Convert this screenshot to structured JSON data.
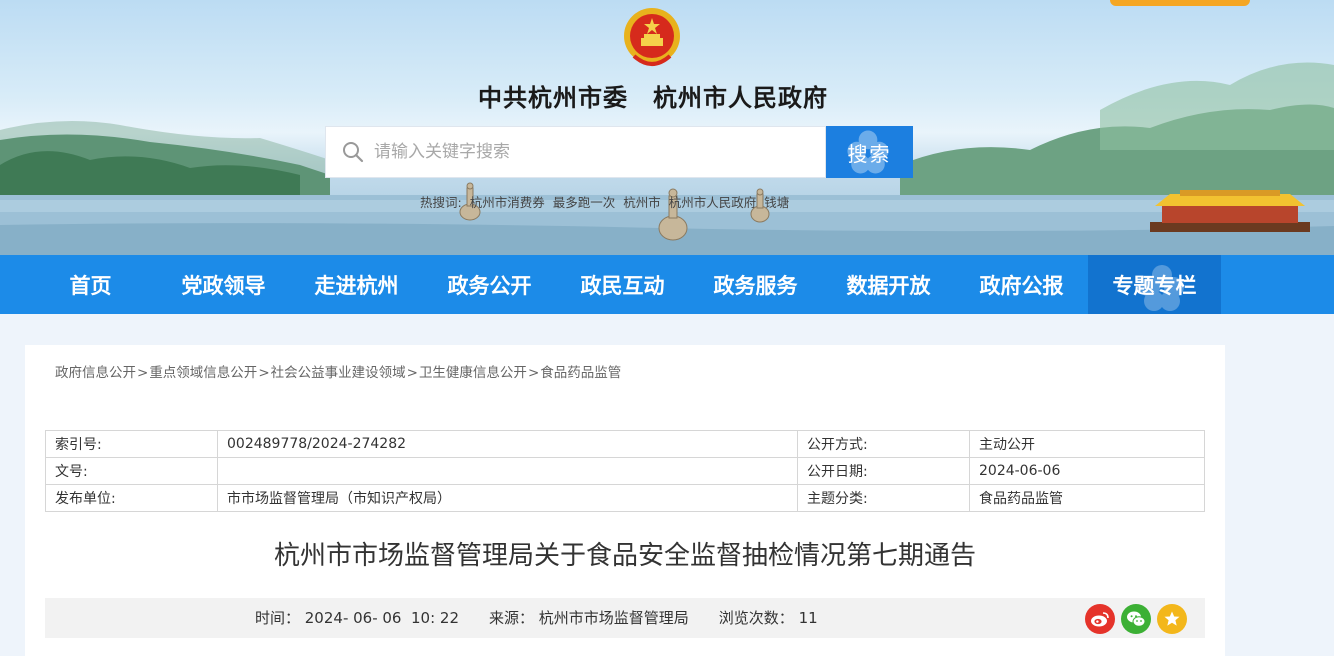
{
  "header": {
    "site_title": "中共杭州市委　杭州市人民政府",
    "search_placeholder": "请输入关键字搜索",
    "search_button": "搜索",
    "hot_words": [
      "热搜词:",
      "杭州市消费券",
      "最多跑一次",
      "杭州市",
      "杭州市人民政府",
      "钱塘"
    ]
  },
  "nav": {
    "items": [
      {
        "label": "首页"
      },
      {
        "label": "党政领导"
      },
      {
        "label": "走进杭州"
      },
      {
        "label": "政务公开"
      },
      {
        "label": "政民互动"
      },
      {
        "label": "政务服务"
      },
      {
        "label": "数据开放"
      },
      {
        "label": "政府公报"
      },
      {
        "label": "专题专栏"
      }
    ],
    "active": "专题专栏"
  },
  "breadcrumb": {
    "items": [
      "政府信息公开",
      "重点领域信息公开",
      "社会公益事业建设领域",
      "卫生健康信息公开",
      "食品药品监管"
    ],
    "separator": ">"
  },
  "meta_table": {
    "rows": [
      {
        "k1": "索引号:",
        "v1": "002489778/2024-274282",
        "k2": "公开方式:",
        "v2": "主动公开"
      },
      {
        "k1": "文号:",
        "v1": "",
        "k2": "公开日期:",
        "v2": "2024-06-06"
      },
      {
        "k1": "发布单位:",
        "v1": "市市场监督管理局（市知识产权局）",
        "k2": "主题分类:",
        "v2": "食品药品监管"
      }
    ]
  },
  "article": {
    "title": "杭州市市场监督管理局关于食品安全监督抽检情况第七期通告",
    "time": "时间： 2024- 06- 06  10: 22",
    "source": "来源： 杭州市市场监督管理局",
    "views": "浏览次数： 11"
  },
  "colors": {
    "nav_bg": "#1c8be8",
    "nav_active": "#1273cf",
    "search_button": "#1c7fe0",
    "weibo": "#e5332a",
    "wechat": "#3cb035",
    "favorite": "#f3b71b",
    "top_tab": "#f5a623"
  },
  "icons": {
    "search": "search-icon",
    "emblem": "national-emblem-icon",
    "share": [
      "weibo-icon",
      "wechat-icon",
      "favorite-star-icon"
    ]
  }
}
